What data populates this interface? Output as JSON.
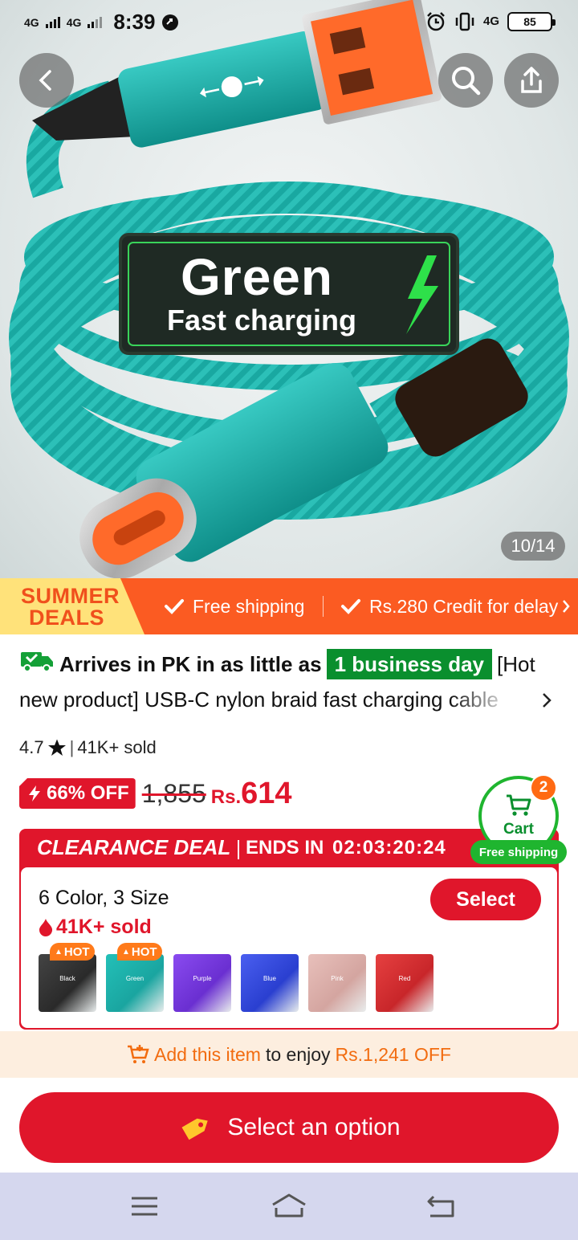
{
  "status_bar": {
    "network_1": "4G",
    "network_2": "4G",
    "time": "8:39",
    "network_3": "4G",
    "battery": "85"
  },
  "hero": {
    "overlay_title": "Green",
    "overlay_subtitle": "Fast charging",
    "page_counter": "10/14"
  },
  "promo": {
    "badge_line1": "SUMMER",
    "badge_line2": "DEALS",
    "item1": "Free shipping",
    "item2": "Rs.280 Credit for delay"
  },
  "product": {
    "arrival_prefix": "Arrives in PK in as little as",
    "arrival_highlight": "1 business day",
    "title": "[Hot new product] USB-C nylon braid fast charging cable",
    "rating": "4.7",
    "sold": "41K+ sold",
    "discount": "66% OFF",
    "old_price": "1,855",
    "currency": "Rs.",
    "price": "614"
  },
  "deal": {
    "title": "CLEARANCE DEAL",
    "ends_label": "ENDS IN",
    "timer": "02:03:20:24",
    "variant_summary": "6 Color, 3 Size",
    "variant_sold": "41K+ sold",
    "select_label": "Select",
    "hot_label": "HOT",
    "swatches": [
      {
        "name": "Black",
        "color": "#2a2a2a",
        "accent": "#444"
      },
      {
        "name": "Green",
        "color": "#1aa5a0",
        "accent": "#23c0b8"
      },
      {
        "name": "Purple",
        "color": "#6a2fd1",
        "accent": "#8a4bf0"
      },
      {
        "name": "Blue",
        "color": "#2a3fd0",
        "accent": "#4a5ff0"
      },
      {
        "name": "Pink",
        "color": "#d4a5a0",
        "accent": "#e8c0bb"
      },
      {
        "name": "Red",
        "color": "#c8262a",
        "accent": "#e64040"
      }
    ]
  },
  "cart": {
    "label": "Cart",
    "count": "2",
    "free_shipping": "Free shipping"
  },
  "addon": {
    "link": "Add this item",
    "middle": "to enjoy",
    "amount": "Rs.1,241 OFF"
  },
  "cta": {
    "label": "Select an option"
  },
  "colors": {
    "brand_red": "#e0162b",
    "promo_orange": "#fb5b22",
    "green": "#0a8f2e"
  }
}
